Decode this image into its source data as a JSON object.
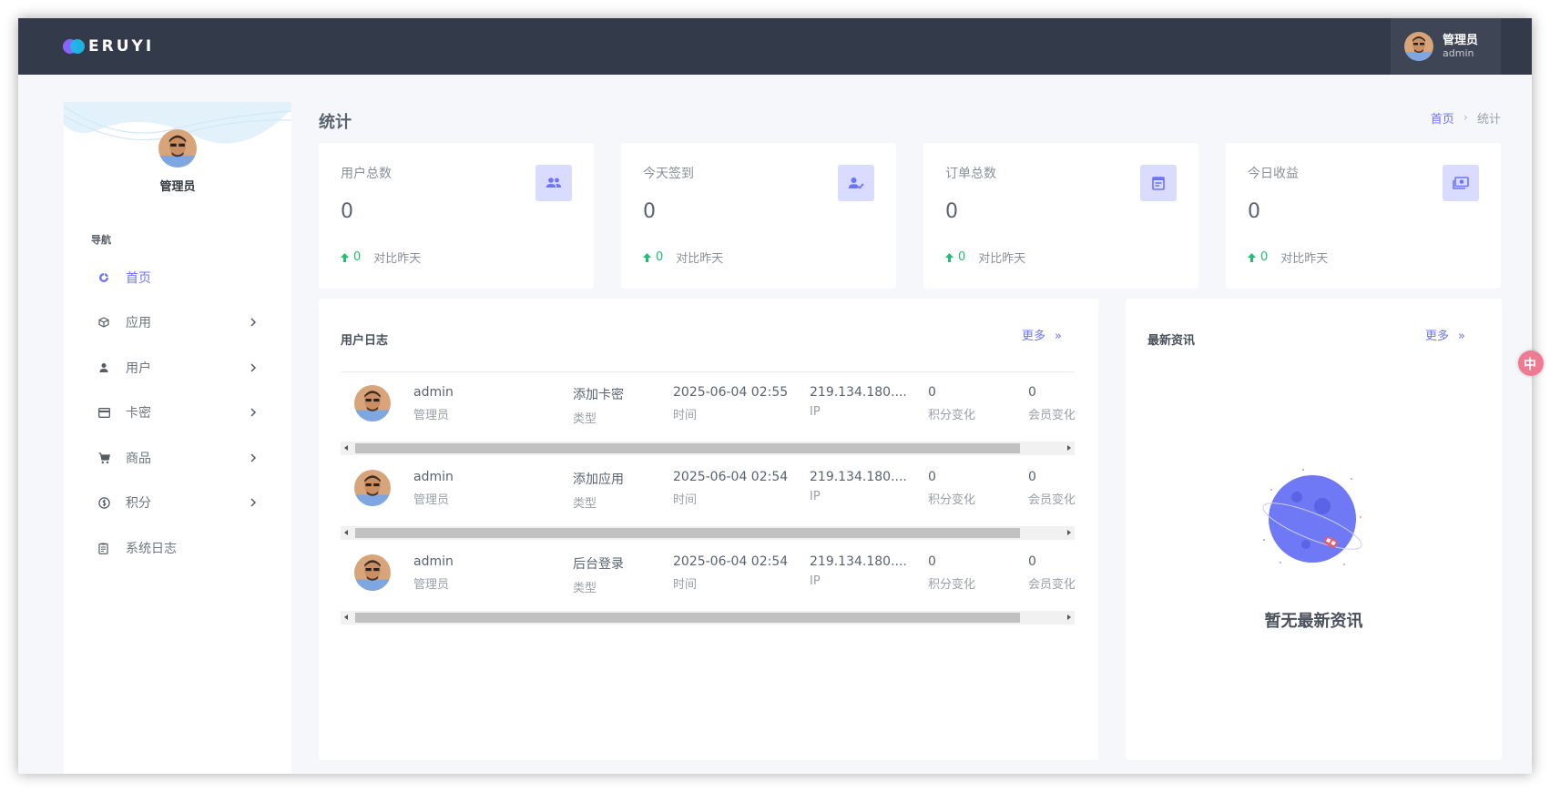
{
  "app": {
    "logo_text": "ERUYI"
  },
  "topbar": {
    "user_name": "管理员",
    "user_role": "admin"
  },
  "sidebar": {
    "profile_name": "管理员",
    "nav_title": "导航",
    "items": [
      {
        "label": "首页",
        "icon": "dashboard-icon",
        "active": true,
        "has_children": false
      },
      {
        "label": "应用",
        "icon": "cube-icon",
        "active": false,
        "has_children": true
      },
      {
        "label": "用户",
        "icon": "user-icon",
        "active": false,
        "has_children": true
      },
      {
        "label": "卡密",
        "icon": "card-icon",
        "active": false,
        "has_children": true
      },
      {
        "label": "商品",
        "icon": "cart-icon",
        "active": false,
        "has_children": true
      },
      {
        "label": "积分",
        "icon": "coin-icon",
        "active": false,
        "has_children": true
      },
      {
        "label": "系统日志",
        "icon": "log-icon",
        "active": false,
        "has_children": false
      }
    ]
  },
  "page": {
    "title": "统计",
    "breadcrumb_home": "首页",
    "breadcrumb_current": "统计"
  },
  "stats": [
    {
      "title": "用户总数",
      "value": "0",
      "delta": "0",
      "compare": "对比昨天",
      "icon": "users-icon"
    },
    {
      "title": "今天签到",
      "value": "0",
      "delta": "0",
      "compare": "对比昨天",
      "icon": "user-check-icon"
    },
    {
      "title": "订单总数",
      "value": "0",
      "delta": "0",
      "compare": "对比昨天",
      "icon": "order-icon"
    },
    {
      "title": "今日收益",
      "value": "0",
      "delta": "0",
      "compare": "对比昨天",
      "icon": "money-icon"
    }
  ],
  "user_log": {
    "title": "用户日志",
    "more": "更多",
    "more_icon": "»",
    "rows": [
      {
        "user": "admin",
        "role": "管理员",
        "type": "添加卡密",
        "type_label": "类型",
        "time": "2025-06-04 02:55",
        "time_label": "时间",
        "ip": "219.134.180....",
        "ip_label": "IP",
        "points": "0",
        "points_label": "积分变化",
        "member": "0",
        "member_label": "会员变化"
      },
      {
        "user": "admin",
        "role": "管理员",
        "type": "添加应用",
        "type_label": "类型",
        "time": "2025-06-04 02:54",
        "time_label": "时间",
        "ip": "219.134.180....",
        "ip_label": "IP",
        "points": "0",
        "points_label": "积分变化",
        "member": "0",
        "member_label": "会员变化"
      },
      {
        "user": "admin",
        "role": "管理员",
        "type": "后台登录",
        "type_label": "类型",
        "time": "2025-06-04 02:54",
        "time_label": "时间",
        "ip": "219.134.180....",
        "ip_label": "IP",
        "points": "0",
        "points_label": "积分变化",
        "member": "0",
        "member_label": "会员变化"
      }
    ]
  },
  "news": {
    "title": "最新资讯",
    "more": "更多",
    "more_icon": "»",
    "empty_text": "暂无最新资讯"
  },
  "colors": {
    "topbar": "#333a49",
    "accent": "#6c73ff",
    "up": "#1fbf72",
    "badge": "#d9dcff"
  }
}
